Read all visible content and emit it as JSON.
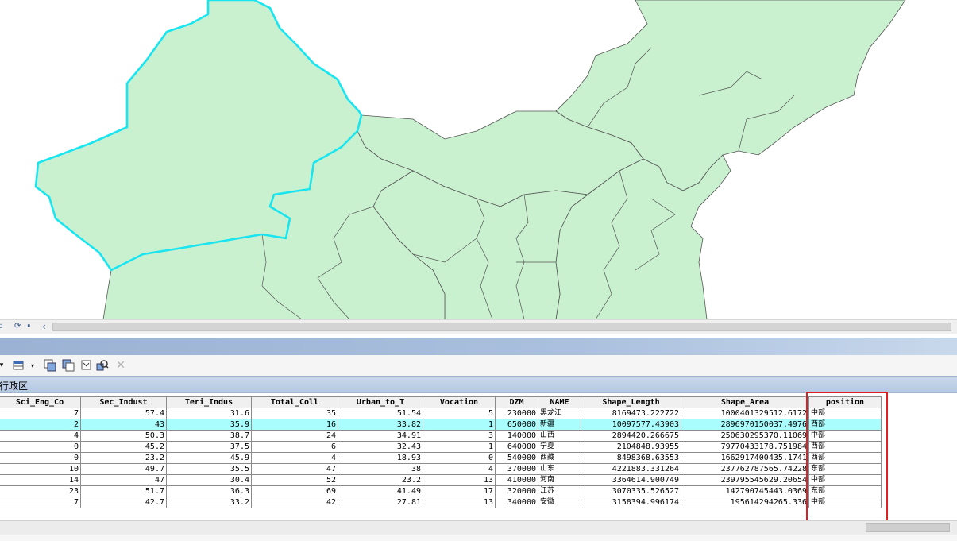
{
  "layer": {
    "tab_label": "行政区"
  },
  "map_toolbar": {
    "refresh_glyph": "⟳",
    "pause_glyph": "⏸",
    "back_glyph": "‹"
  },
  "table_toolbar": {
    "icons": [
      "table-options-icon",
      "select-by-attributes-icon",
      "switch-selection-icon",
      "clear-selection-icon",
      "zoom-to-selected-icon",
      "delete-selected-icon"
    ]
  },
  "columns": [
    "Sci_Eng_Co",
    "Sec_Indust",
    "Teri_Indus",
    "Total_Coll",
    "Urban_to_T",
    "Vocation",
    "DZM",
    "NAME",
    "Shape_Length",
    "Shape_Area",
    "position"
  ],
  "rows": [
    [
      "7",
      "57.4",
      "31.6",
      "35",
      "51.54",
      "5",
      "230000",
      "黑龙江",
      "8169473.222722",
      "1000401329512.6172",
      "中部"
    ],
    [
      "2",
      "43",
      "35.9",
      "16",
      "33.82",
      "1",
      "650000",
      "新疆",
      "10097577.43903",
      "2896970150037.4976",
      "西部"
    ],
    [
      "4",
      "50.3",
      "38.7",
      "24",
      "34.91",
      "3",
      "140000",
      "山西",
      "2894420.266675",
      "250630295370.11069",
      "中部"
    ],
    [
      "0",
      "45.2",
      "37.5",
      "6",
      "32.43",
      "1",
      "640000",
      "宁夏",
      "2104848.93955",
      "79770433178.751984",
      "西部"
    ],
    [
      "0",
      "23.2",
      "45.9",
      "4",
      "18.93",
      "0",
      "540000",
      "西藏",
      "8498368.63553",
      "1662917400435.1741",
      "西部"
    ],
    [
      "10",
      "49.7",
      "35.5",
      "47",
      "38",
      "4",
      "370000",
      "山东",
      "4221883.331264",
      "237762787565.74228",
      "东部"
    ],
    [
      "14",
      "47",
      "30.4",
      "52",
      "23.2",
      "13",
      "410000",
      "河南",
      "3364614.900749",
      "239795545629.20654",
      "中部"
    ],
    [
      "23",
      "51.7",
      "36.3",
      "69",
      "41.49",
      "17",
      "320000",
      "江苏",
      "3070335.526527",
      "142790745443.0369",
      "东部"
    ],
    [
      "7",
      "42.7",
      "33.2",
      "42",
      "27.81",
      "13",
      "340000",
      "安徽",
      "3158394.996174",
      "195614294265.336",
      "中部"
    ]
  ],
  "selected_row_index": 1,
  "colors": {
    "map_fill": "#c9f1cf",
    "boundary": "#555555",
    "selected_outline": "#19e5f0",
    "selected_row": "#a9fdfd",
    "highlight_box": "#e02020"
  }
}
